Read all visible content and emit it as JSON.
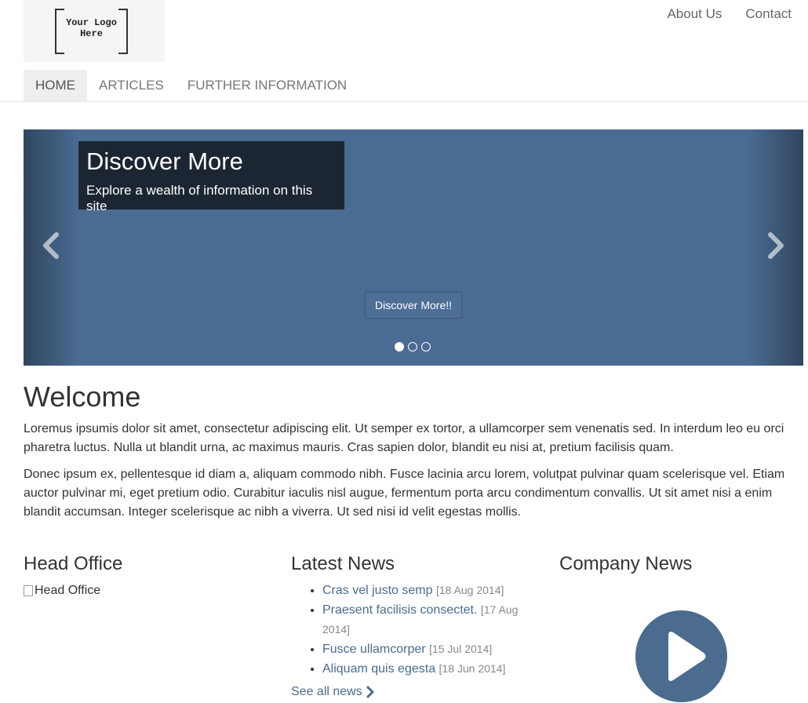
{
  "header": {
    "logo_text": "Your Logo\nHere",
    "top_links": [
      "About Us",
      "Contact"
    ],
    "nav": [
      {
        "label": "HOME",
        "active": true
      },
      {
        "label": "ARTICLES",
        "active": false
      },
      {
        "label": "FURTHER INFORMATION",
        "active": false
      }
    ]
  },
  "carousel": {
    "title": "Discover More",
    "subtitle": "Explore a wealth of information on this site",
    "button_label": "Discover More!!",
    "slides": 3,
    "active_slide": 1,
    "bg_color": "#4a6b92"
  },
  "welcome": {
    "title": "Welcome",
    "paragraph1": "Loremus ipsumis dolor sit amet, consectetur adipiscing elit. Ut semper ex tortor, a ullamcorper sem venenatis sed. In interdum leo eu orci pharetra luctus. Nulla ut blandit urna, ac maximus mauris. Cras sapien dolor, blandit eu nisi at, pretium facilisis quam.",
    "paragraph2": "Donec ipsum ex, pellentesque id diam a, aliquam commodo nibh. Fusce lacinia arcu lorem, volutpat pulvinar quam scelerisque vel. Etiam auctor pulvinar mi, eget pretium odio. Curabitur iaculis nisl augue, fermentum porta arcu condimentum convallis. Ut sit amet nisi a enim blandit accumsan. Integer scelerisque ac nibh a viverra. Ut sed nisi id velit egestas mollis."
  },
  "head_office": {
    "title": "Head Office",
    "image_alt": "Head Office"
  },
  "latest_news": {
    "title": "Latest News",
    "items": [
      {
        "title": "Cras vel justo semp",
        "date": "[18 Aug 2014]"
      },
      {
        "title": "Praesent facilisis consectet.",
        "date": "[17 Aug 2014]"
      },
      {
        "title": "Fusce ullamcorper",
        "date": "[15 Jul 2014]"
      },
      {
        "title": "Aliquam quis egesta",
        "date": "[18 Jun 2014]"
      }
    ],
    "see_all_label": "See all news"
  },
  "company_news": {
    "title": "Company News"
  },
  "colors": {
    "link": "#4b6b8f",
    "nav_active_bg": "#eeeeee"
  }
}
